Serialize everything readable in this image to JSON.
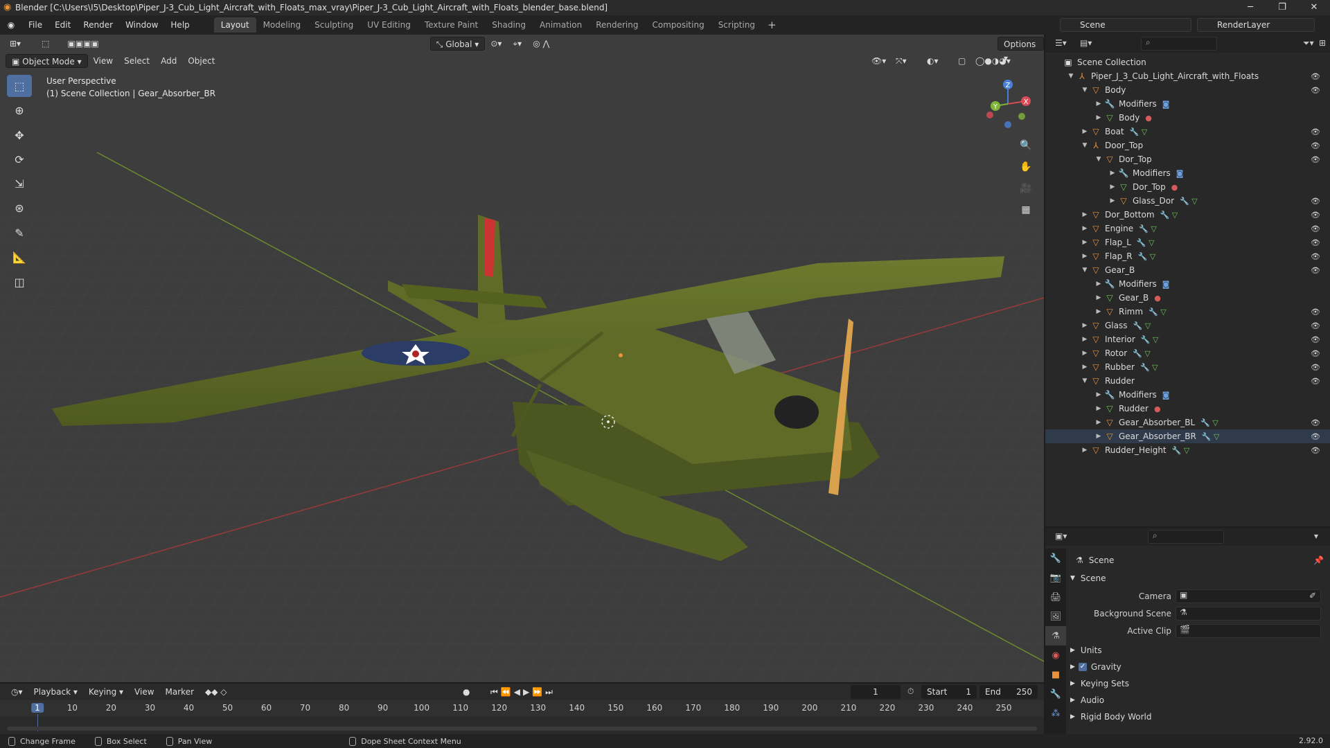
{
  "window": {
    "title": "Blender [C:\\Users\\I5\\Desktop\\Piper_J-3_Cub_Light_Aircraft_with_Floats_max_vray\\Piper_J-3_Cub_Light_Aircraft_with_Floats_blender_base.blend]"
  },
  "menu": {
    "items": [
      "File",
      "Edit",
      "Render",
      "Window",
      "Help"
    ],
    "workspaces": [
      "Layout",
      "Modeling",
      "Sculpting",
      "UV Editing",
      "Texture Paint",
      "Shading",
      "Animation",
      "Rendering",
      "Compositing",
      "Scripting"
    ],
    "active_workspace": "Layout",
    "scene": "Scene",
    "view_layer": "RenderLayer"
  },
  "viewport": {
    "mode": "Object Mode",
    "menus": [
      "View",
      "Select",
      "Add",
      "Object"
    ],
    "orientation": "Global",
    "options": "Options",
    "perspective": "User Perspective",
    "context": "(1) Scene Collection | Gear_Absorber_BR",
    "gizmo_axes": [
      "X",
      "Y",
      "Z"
    ]
  },
  "outliner": {
    "root": "Scene Collection",
    "rows": [
      {
        "label": "Scene Collection",
        "depth": 0,
        "icon": "collection",
        "tri": ""
      },
      {
        "label": "Piper_J_3_Cub_Light_Aircraft_with_Floats",
        "depth": 1,
        "icon": "empty",
        "tri": "down",
        "eye": true
      },
      {
        "label": "Body",
        "depth": 2,
        "icon": "object",
        "tri": "down",
        "eye": true
      },
      {
        "label": "Modifiers",
        "depth": 3,
        "icon": "modifier",
        "tri": "right",
        "extra": "mod"
      },
      {
        "label": "Body",
        "depth": 3,
        "icon": "mesh",
        "tri": "right",
        "extra": "mat"
      },
      {
        "label": "Boat",
        "depth": 2,
        "icon": "object",
        "tri": "right",
        "extra": "modmesh",
        "eye": true
      },
      {
        "label": "Door_Top",
        "depth": 2,
        "icon": "empty",
        "tri": "down",
        "eye": true
      },
      {
        "label": "Dor_Top",
        "depth": 3,
        "icon": "object",
        "tri": "down",
        "eye": true
      },
      {
        "label": "Modifiers",
        "depth": 4,
        "icon": "modifier",
        "tri": "right",
        "extra": "mod"
      },
      {
        "label": "Dor_Top",
        "depth": 4,
        "icon": "mesh",
        "tri": "right",
        "extra": "mat"
      },
      {
        "label": "Glass_Dor",
        "depth": 4,
        "icon": "object",
        "tri": "right",
        "extra": "modmesh",
        "eye": true
      },
      {
        "label": "Dor_Bottom",
        "depth": 2,
        "icon": "object",
        "tri": "right",
        "extra": "modmesh",
        "eye": true
      },
      {
        "label": "Engine",
        "depth": 2,
        "icon": "object",
        "tri": "right",
        "extra": "modmesh",
        "eye": true
      },
      {
        "label": "Flap_L",
        "depth": 2,
        "icon": "object",
        "tri": "right",
        "extra": "modmesh",
        "eye": true
      },
      {
        "label": "Flap_R",
        "depth": 2,
        "icon": "object",
        "tri": "right",
        "extra": "modmesh",
        "eye": true
      },
      {
        "label": "Gear_B",
        "depth": 2,
        "icon": "object",
        "tri": "down",
        "eye": true
      },
      {
        "label": "Modifiers",
        "depth": 3,
        "icon": "modifier",
        "tri": "right",
        "extra": "mod"
      },
      {
        "label": "Gear_B",
        "depth": 3,
        "icon": "mesh",
        "tri": "right",
        "extra": "mat"
      },
      {
        "label": "Rimm",
        "depth": 3,
        "icon": "object",
        "tri": "right",
        "extra": "modmesh",
        "eye": true
      },
      {
        "label": "Glass",
        "depth": 2,
        "icon": "object",
        "tri": "right",
        "extra": "modmesh",
        "eye": true
      },
      {
        "label": "Interior",
        "depth": 2,
        "icon": "object",
        "tri": "right",
        "extra": "modmesh",
        "eye": true
      },
      {
        "label": "Rotor",
        "depth": 2,
        "icon": "object",
        "tri": "right",
        "extra": "modmesh",
        "eye": true
      },
      {
        "label": "Rubber",
        "depth": 2,
        "icon": "object",
        "tri": "right",
        "extra": "modmesh",
        "eye": true
      },
      {
        "label": "Rudder",
        "depth": 2,
        "icon": "object",
        "tri": "down",
        "eye": true
      },
      {
        "label": "Modifiers",
        "depth": 3,
        "icon": "modifier",
        "tri": "right",
        "extra": "mod"
      },
      {
        "label": "Rudder",
        "depth": 3,
        "icon": "mesh",
        "tri": "right",
        "extra": "mat"
      },
      {
        "label": "Gear_Absorber_BL",
        "depth": 3,
        "icon": "object",
        "tri": "right",
        "extra": "modmesh",
        "eye": true
      },
      {
        "label": "Gear_Absorber_BR",
        "depth": 3,
        "icon": "object",
        "tri": "right",
        "extra": "modmesh",
        "eye": true,
        "selected": true
      },
      {
        "label": "Rudder_Height",
        "depth": 2,
        "icon": "object",
        "tri": "right",
        "extra": "modmesh",
        "eye": true
      }
    ]
  },
  "properties": {
    "context": "Scene",
    "panel": "Scene",
    "camera_label": "Camera",
    "background_scene_label": "Background Scene",
    "active_clip_label": "Active Clip",
    "sections": [
      "Units",
      "Gravity",
      "Keying Sets",
      "Audio",
      "Rigid Body World"
    ],
    "gravity_checked": true,
    "version": "2.92.0"
  },
  "timeline": {
    "menus": [
      "Playback",
      "Keying",
      "View",
      "Marker"
    ],
    "current_frame": "1",
    "start_label": "Start",
    "start": "1",
    "end_label": "End",
    "end": "250",
    "ticks": [
      "1",
      "10",
      "20",
      "30",
      "40",
      "50",
      "60",
      "70",
      "80",
      "90",
      "100",
      "110",
      "120",
      "130",
      "140",
      "150",
      "160",
      "170",
      "180",
      "190",
      "200",
      "210",
      "220",
      "230",
      "240",
      "250"
    ]
  },
  "statusbar": {
    "items": [
      "Change Frame",
      "Box Select",
      "Pan View",
      "Dope Sheet Context Menu"
    ]
  },
  "colors": {
    "accent": "#4f6fa0",
    "object_icon": "#e8923c",
    "mesh_icon": "#6fc25a",
    "modifier_icon": "#6d9fe2",
    "material_icon": "#d75a5a",
    "aircraft_green": "#5f6b27"
  }
}
